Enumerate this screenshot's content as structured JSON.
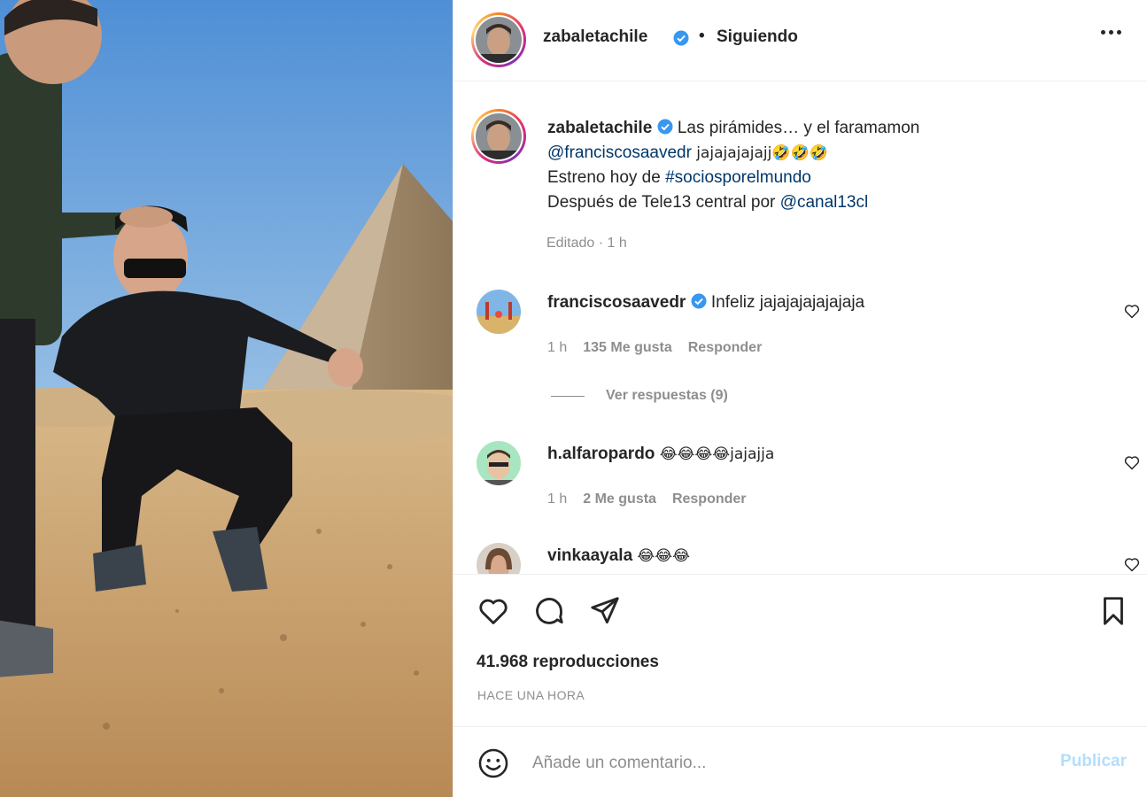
{
  "post": {
    "author": "zabaletachile",
    "follow_separator": "•",
    "follow_status": "Siguiendo",
    "verified": true
  },
  "caption": {
    "username": "zabaletachile",
    "line1_text": "Las pirámides… y el faramamon",
    "line2_mention": "@franciscosaavedr",
    "line2_text": "jajajajajajj🤣🤣🤣",
    "line3_text": "Estreno hoy de",
    "line3_hashtag": "#sociosporelmundo",
    "line4_text": "Después de Tele13 central por",
    "line4_mention": "@canal13cl",
    "meta": "Editado · 1 h"
  },
  "comments": [
    {
      "username": "franciscosaavedr",
      "verified": true,
      "text": "Infeliz jajajajajajajaja",
      "time": "1 h",
      "likes": "135 Me gusta",
      "reply_label": "Responder"
    },
    {
      "username": "h.alfaropardo",
      "verified": false,
      "text": "😂😂😂😂jajajja",
      "time": "1 h",
      "likes": "2 Me gusta",
      "reply_label": "Responder"
    },
    {
      "username": "vinkaayala",
      "verified": false,
      "text": "😂😂😂"
    }
  ],
  "view_replies": "Ver respuestas (9)",
  "stats": {
    "views": "41.968 reproducciones",
    "posted": "HACE UNA HORA"
  },
  "add_comment": {
    "placeholder": "Añade un comentario...",
    "publish_label": "Publicar"
  },
  "icons": {
    "like": "heart-icon",
    "comment": "comment-icon",
    "share": "share-icon",
    "save": "bookmark-icon",
    "emoji": "emoji-icon",
    "more": "more-options-icon",
    "verified": "verified-badge-icon"
  },
  "colors": {
    "link": "#00376b",
    "verified": "#3897f0",
    "publish_disabled": "#b2dffc",
    "secondary_text": "#8e8e8e"
  }
}
